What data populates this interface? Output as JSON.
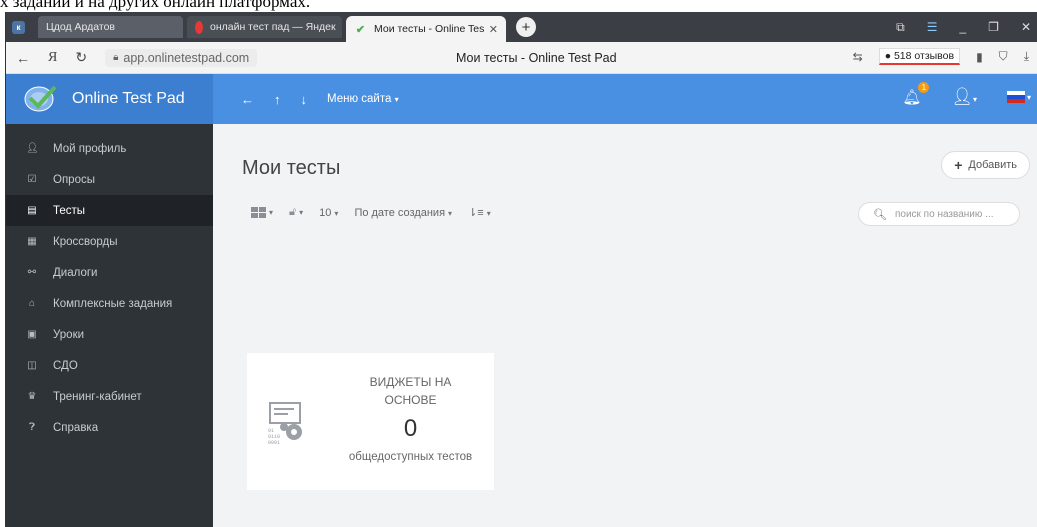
{
  "caption": "х заданий и на других онлайн платформах.",
  "tabs": [
    {
      "label": "Цдод Ардатов",
      "icon": "vk-icon"
    },
    {
      "label": "онлайн тест пад — Яндек",
      "icon": "yandex-icon"
    },
    {
      "label": "Мои тесты - Online Tes",
      "icon": "otp-logo-icon",
      "active": true
    }
  ],
  "address": {
    "url": "app.onlinetestpad.com",
    "title": "Мои тесты - Online Test Pad",
    "reviews": "518 отзывов",
    "search_engine_letter": "Я"
  },
  "header": {
    "brand": "Online Test Pad",
    "menu_label": "Меню сайта",
    "notification_count": "1"
  },
  "sidebar": {
    "items": [
      {
        "label": "Мой профиль",
        "icon": "user-icon"
      },
      {
        "label": "Опросы",
        "icon": "survey-icon"
      },
      {
        "label": "Тесты",
        "icon": "test-icon",
        "active": true
      },
      {
        "label": "Кроссворды",
        "icon": "crossword-icon"
      },
      {
        "label": "Диалоги",
        "icon": "dialog-icon"
      },
      {
        "label": "Комплексные задания",
        "icon": "complex-task-icon"
      },
      {
        "label": "Уроки",
        "icon": "lesson-icon"
      },
      {
        "label": "СДО",
        "icon": "lms-icon"
      },
      {
        "label": "Тренинг-кабинет",
        "icon": "training-icon"
      },
      {
        "label": "Справка",
        "icon": "help-icon"
      }
    ]
  },
  "main": {
    "title": "Мои тесты",
    "add_label": "Добавить",
    "page_size": "10",
    "sort_label": "По дате создания",
    "search_placeholder": "поиск по названию ..."
  },
  "widget": {
    "title": "ВИДЖЕТЫ НА ОСНОВЕ",
    "count": "0",
    "subtitle": "общедоступных тестов"
  },
  "colors": {
    "header": "#4a90e2",
    "sidebar": "#2e3338",
    "content_bg": "#f1f3f5"
  }
}
